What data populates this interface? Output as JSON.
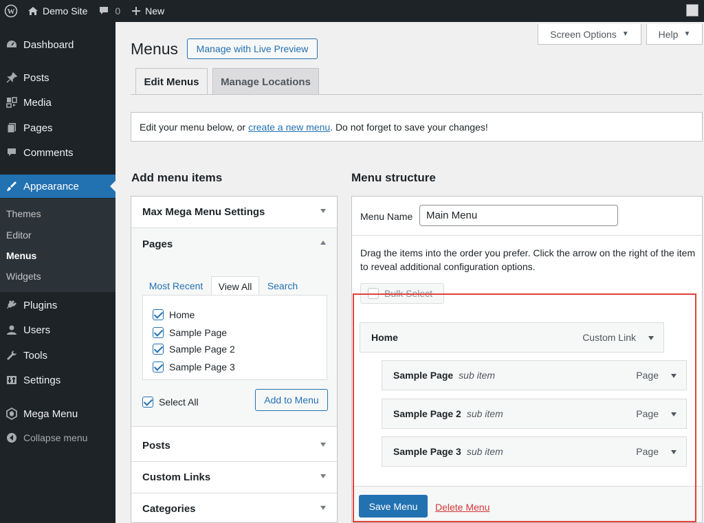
{
  "adminbar": {
    "site_name": "Demo Site",
    "comments_count": "0",
    "new_label": "New"
  },
  "sidebar": {
    "items": [
      {
        "label": "Dashboard",
        "icon": "dashboard-icon"
      },
      {
        "label": "Posts",
        "icon": "pin-icon"
      },
      {
        "label": "Media",
        "icon": "media-icon"
      },
      {
        "label": "Pages",
        "icon": "pages-icon"
      },
      {
        "label": "Comments",
        "icon": "comment-icon"
      },
      {
        "label": "Appearance",
        "icon": "brush-icon"
      },
      {
        "label": "Plugins",
        "icon": "plugin-icon"
      },
      {
        "label": "Users",
        "icon": "user-icon"
      },
      {
        "label": "Tools",
        "icon": "wrench-icon"
      },
      {
        "label": "Settings",
        "icon": "settings-icon"
      },
      {
        "label": "Mega Menu",
        "icon": "mega-menu-icon"
      }
    ],
    "submenu": [
      "Themes",
      "Editor",
      "Menus",
      "Widgets"
    ],
    "collapse_label": "Collapse menu"
  },
  "screen_options_label": "Screen Options",
  "help_label": "Help",
  "page": {
    "title": "Menus",
    "live_preview_label": "Manage with Live Preview",
    "tabs": [
      "Edit Menus",
      "Manage Locations"
    ],
    "notice": {
      "before": "Edit your menu below, or",
      "link": "create a new menu",
      "after": ". Do not forget to save your changes!"
    }
  },
  "add_items": {
    "heading": "Add menu items",
    "sections": [
      "Max Mega Menu Settings",
      "Pages",
      "Posts",
      "Custom Links",
      "Categories"
    ],
    "page_tabs": [
      "Most Recent",
      "View All",
      "Search"
    ],
    "pages": [
      "Home",
      "Sample Page",
      "Sample Page 2",
      "Sample Page 3"
    ],
    "select_all_label": "Select All",
    "add_button_label": "Add to Menu"
  },
  "structure": {
    "heading": "Menu structure",
    "menu_name_label": "Menu Name",
    "menu_name_value": "Main Menu",
    "instructions": "Drag the items into the order you prefer. Click the arrow on the right of the item to reveal additional configuration options.",
    "bulk_select_label": "Bulk Select",
    "items": [
      {
        "title": "Home",
        "sub": "",
        "type": "Custom Link"
      },
      {
        "title": "Sample Page",
        "sub": "sub item",
        "type": "Page"
      },
      {
        "title": "Sample Page 2",
        "sub": "sub item",
        "type": "Page"
      },
      {
        "title": "Sample Page 3",
        "sub": "sub item",
        "type": "Page"
      }
    ],
    "save_label": "Save Menu",
    "delete_label": "Delete Menu"
  },
  "colors": {
    "accent": "#2271b1",
    "admin_dark": "#1d2327",
    "delete_red": "#d63638",
    "highlight_red": "#e0403a"
  }
}
